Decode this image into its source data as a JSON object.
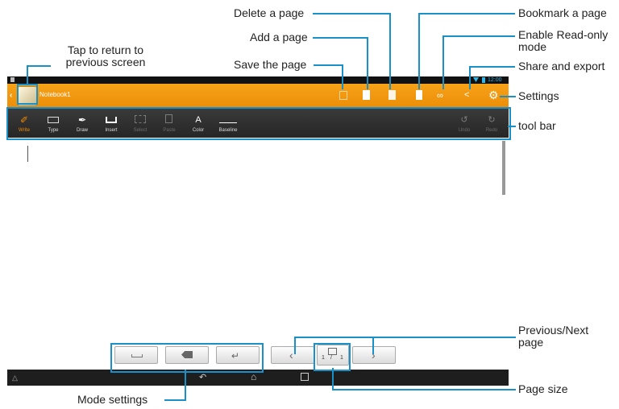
{
  "callouts": {
    "tap_return": "Tap to return to\nprevious screen",
    "delete_page": "Delete a page",
    "add_page": "Add a page",
    "save_page": "Save the page",
    "bookmark_page": "Bookmark a page",
    "read_only": "Enable Read-only\nmode",
    "share_export": "Share and export",
    "settings": "Settings",
    "tool_bar": "tool bar",
    "prev_next": "Previous/Next\npage",
    "page_size": "Page size",
    "mode_settings": "Mode settings"
  },
  "status": {
    "time": "12:00"
  },
  "app": {
    "title": "Notebook1"
  },
  "toolbar": {
    "write": "Write",
    "type": "Type",
    "draw": "Draw",
    "insert": "Insert",
    "select": "Select",
    "paste": "Paste",
    "color": "Color",
    "baseline": "Baseline",
    "undo": "Undo",
    "redo": "Redo"
  },
  "pager": {
    "current": "1",
    "separator": "/",
    "total": "1"
  },
  "colors": {
    "accent": "#ec8d08",
    "callout_line": "#1a90c8",
    "active_tool": "#f08a00"
  }
}
